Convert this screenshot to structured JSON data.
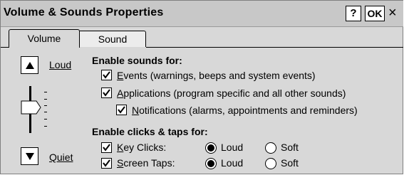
{
  "window": {
    "title": "Volume & Sounds Properties",
    "help_label": "?",
    "ok_label": "OK",
    "close_label": "×"
  },
  "tabs": [
    {
      "label": "Volume",
      "active": true
    },
    {
      "label": "Sound",
      "active": false
    }
  ],
  "volume": {
    "loud_label": "Loud",
    "quiet_label": "Quiet",
    "level": 0.33
  },
  "enable_sounds": {
    "heading": "Enable sounds for:",
    "items": [
      {
        "access": "E",
        "rest": "vents (warnings, beeps and system events)",
        "checked": true
      },
      {
        "access": "A",
        "rest": "pplications (program specific and all other sounds)",
        "checked": true
      },
      {
        "access": "N",
        "rest": "otifications (alarms, appointments and reminders)",
        "checked": true
      }
    ]
  },
  "clicks_taps": {
    "heading": "Enable clicks & taps for:",
    "rows": [
      {
        "access": "K",
        "rest": "ey Clicks:",
        "checked": true,
        "loud": "Loud",
        "soft": "Soft",
        "selected": "Loud"
      },
      {
        "access": "S",
        "rest": "creen Taps:",
        "checked": true,
        "loud": "Loud",
        "soft": "Soft",
        "selected": "Loud"
      }
    ]
  }
}
